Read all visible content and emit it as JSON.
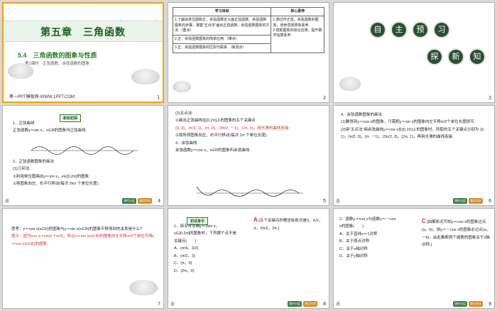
{
  "slides": [
    {
      "number": "1",
      "side": "",
      "chapter_title": "第五章　三角函数",
      "subtitle": "5.4　三角函数的图象与性质",
      "lesson": "第1课时　正弦函数、余弦函数的图象",
      "publisher": "第一PPT模板网-WWW.1PPT.COM"
    },
    {
      "number": "2",
      "side": "",
      "table": {
        "headers": [
          "学习目标",
          "核心素养"
        ],
        "rows": [
          [
            "1.了解由单位圆和正、余弦函数定义画正弦函数、余弦函数图象的步骤，掌握“五点法”画出正弦函数、余弦函数图象的方法.（重点）",
            "1.通过作正弦、余弦函数的图象，培养直观想象素养."
          ],
          [
            "2.正、余弦函数图象的简单应用.（难点）",
            "2.借助图象的综合应用，提升数学运算素养."
          ],
          [
            "3.正、余弦函数图象的区别与联系.（易混点）",
            ""
          ]
        ]
      }
    },
    {
      "number": "3",
      "side": "",
      "row1": [
        "自",
        "主",
        "预",
        "习"
      ],
      "row2": [
        "探",
        "新",
        "知"
      ]
    },
    {
      "number": "4",
      "side": "返",
      "tag": "新知初探",
      "lines": [
        "1．正弦曲线",
        "正弦函数y＝sin x，x∈R的图象叫正弦曲线.",
        "2．正弦函数图象的画法",
        "(1)几何法:",
        "①利用单位圆画出y＝sin x，x∈[0,2π]的图象;",
        "②将图象向左、右平行移动(每次 2kπ 个单位长度)."
      ]
    },
    {
      "number": "5",
      "side": "",
      "lines": [
        "(2)五点法:",
        "①画出正弦曲线在[0,2π]上的图象的五个关键点",
        "(0, 0)，(π/2, 1)，(π, 0)，(3π/2, －1)，(2π, 0)，用光滑的曲线连接;",
        "②将所得图象向左、右平行移动(每次 2π 个单位长度).",
        "3．余弦曲线",
        "余弦函数y＝cos x，x∈R的图象叫余弦曲线."
      ]
    },
    {
      "number": "6",
      "side": "返",
      "lines": [
        "4．余弦函数图象的画法",
        "(1)要得到y＝cos x的图象，只需把y＝sin x的图象向左平移π/2个单位长度即可.",
        "(2)用“五点法”画余弦曲线y＝cos x在[0,2π]上的图象时，所取的五个关键点分别为 (0, 1)，(π/2, 0)，(π, －1)，(3π/2, 0)，(2π, 1)，再用光滑的曲线连接."
      ]
    },
    {
      "number": "7",
      "side": "",
      "lines": [
        "思考：y＝cos x(x∈R)的图象与y＝sin x(x∈R)的图象平移得到的关系是什么?",
        "提示：因为cos x＝sin(x＋π/2)，所以y＝sin x(x∈R)的图象向左平移π/2个单位可得y＝cos x(x∈R)的图象."
      ]
    },
    {
      "number": "8",
      "side": "返",
      "tag": "初试身手",
      "question": [
        "1．用五点法画y＝3sin x，",
        "x∈[0,2π]的图象时，下列哪个点不是",
        "关键点(　　)"
      ],
      "options": [
        "A．(π/6，3/2)",
        "B．(π/2，3)",
        "C．(π，0)",
        "D．(2π，0)"
      ],
      "answer": "A",
      "explain": "[五个关键点的横坐标依次是0，π/2，π，3π/2，2π.]"
    },
    {
      "number": "9",
      "side": "返",
      "question": [
        "2．函数y＝cos x与函数y＝－cos",
        "x的图象(　　)"
      ],
      "options": [
        "A．关于直线x＝1对称",
        "B．关于原点对称",
        "C．关于x轴对称",
        "D．关于y轴对称"
      ],
      "answer": "C",
      "explain": "[由解析式可知y＝cos x的图象过点(a，b)，则y＝－cos x的图象必过点(a，－b)，由此推断两个函数的图象关于x轴对称.]"
    }
  ],
  "footer_buttons": [
    "课时分层",
    "课后作业"
  ],
  "colors": {
    "selection": "#f0a30a",
    "accent": "#2e7d32",
    "highlight": "#d32f2f"
  }
}
